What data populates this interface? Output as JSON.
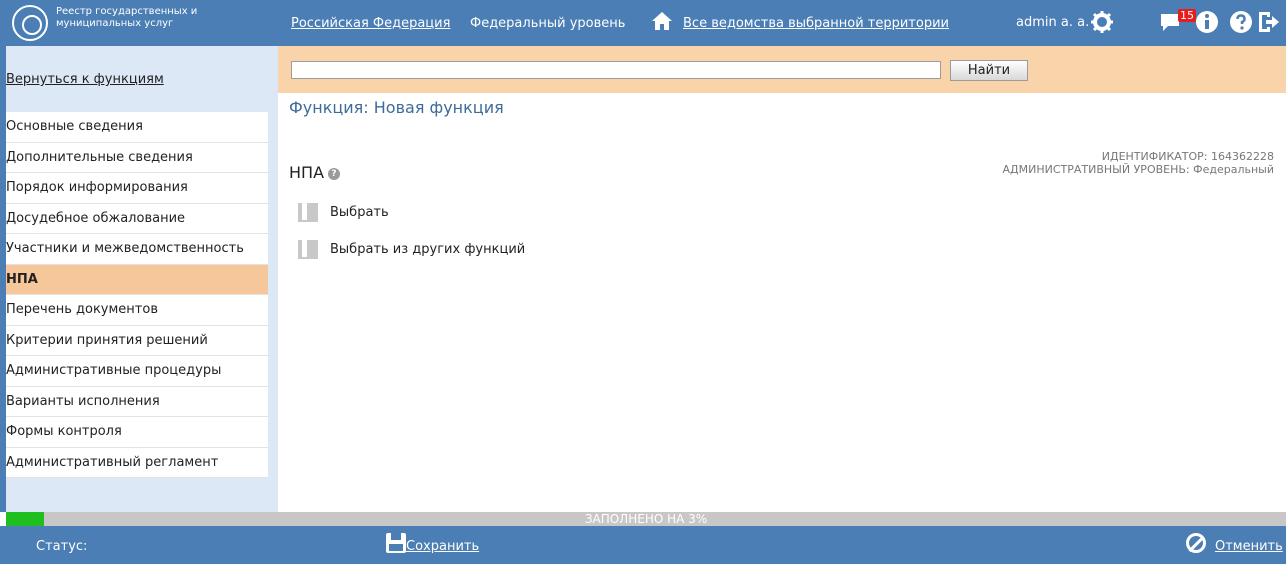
{
  "header": {
    "app_title": "Реестр государственных и муниципальных услуг",
    "region": "Российская Федерация",
    "level": "Федеральный уровень",
    "departments": "Все ведомства выбранной территории",
    "user": "admin a. a.",
    "notifications_count": "15",
    "icons": [
      "logo-icon",
      "home-icon",
      "gear-icon",
      "chat-icon",
      "info-icon",
      "help-icon",
      "logout-icon"
    ]
  },
  "sidebar": {
    "back_link": "Вернуться к функциям",
    "items": [
      {
        "label": "Основные сведения"
      },
      {
        "label": "Дополнительные сведения"
      },
      {
        "label": "Порядок информирования"
      },
      {
        "label": "Досудебное обжалование"
      },
      {
        "label": "Участники и межведомственность"
      },
      {
        "label": "НПА",
        "active": true
      },
      {
        "label": "Перечень документов"
      },
      {
        "label": "Критерии принятия решений"
      },
      {
        "label": "Административные процедуры"
      },
      {
        "label": "Варианты исполнения"
      },
      {
        "label": "Формы контроля"
      },
      {
        "label": "Административный регламент"
      }
    ]
  },
  "search": {
    "value": "",
    "button_label": "Найти"
  },
  "main": {
    "page_title": "Функция: Новая функция",
    "section_title": "НПА",
    "help_glyph": "?",
    "identifier": "ИДЕНТИФИКАТОР: 164362228",
    "admin_level": "АДМИНИСТРАТИВНЫЙ УРОВЕНЬ: Федеральный",
    "actions": [
      {
        "label": "Выбрать"
      },
      {
        "label": "Выбрать из других функций"
      }
    ]
  },
  "progress": {
    "percent": 3,
    "label": "ЗАПОЛНЕНО НА 3%"
  },
  "statusbar": {
    "status_label": "Статус:",
    "save_label": "Сохранить",
    "cancel_label": "Отменить"
  },
  "colors": {
    "header_bg": "#4a7eb4",
    "sidebar_bg": "#dce8f5",
    "search_bg": "#f9d3a9",
    "active_item": "#f5c79a",
    "progress_fill": "#1fbf1f",
    "progress_bg": "#c7c7c7",
    "title_color": "#3d6b9a"
  }
}
